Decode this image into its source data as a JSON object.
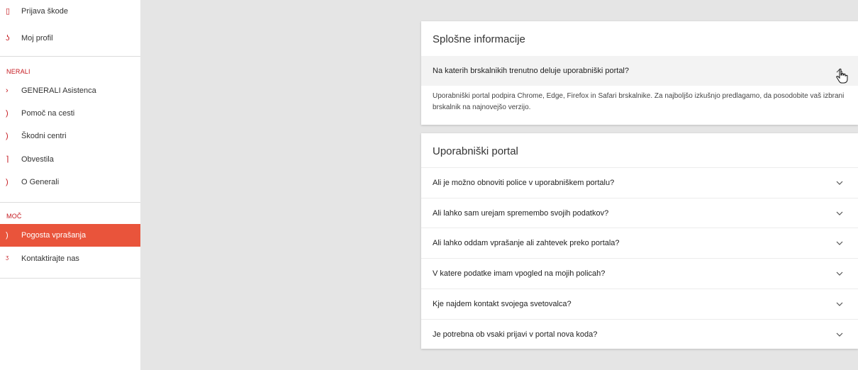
{
  "sidebar": {
    "items_top": [
      {
        "label": "Prijava škode",
        "icon": "document-icon"
      },
      {
        "label": "Moj profil",
        "icon": "user-icon"
      }
    ],
    "section_generali": "NERALI",
    "items_generali": [
      {
        "label": "GENERALI Asistenca",
        "icon": "phone-icon"
      },
      {
        "label": "Pomoč na cesti",
        "icon": "car-icon"
      },
      {
        "label": "Škodni centri",
        "icon": "location-icon"
      },
      {
        "label": "Obvestila",
        "icon": "bell-icon"
      },
      {
        "label": "O Generali",
        "icon": "info-icon"
      }
    ],
    "section_pomoc": "MOČ",
    "items_pomoc": [
      {
        "label": "Pogosta vprašanja",
        "icon": "question-icon",
        "active": true
      },
      {
        "label": "Kontaktirajte nas",
        "icon": "mail-icon"
      }
    ]
  },
  "general_card": {
    "title": "Splošne informacije",
    "question": "Na katerih brskalnikih trenutno deluje uporabniški portal?",
    "answer": "Uporabniški portal podpira Chrome, Edge, Firefox in Safari brskalnike. Za najboljšo izkušnjo predlagamo, da posodobite vaš izbrani brskalnik na najnovejšo verzijo."
  },
  "portal_card": {
    "title": "Uporabniški portal",
    "questions": [
      "Ali je možno obnoviti police v uporabniškem portalu?",
      "Ali lahko sam urejam spremembo svojih podatkov?",
      "Ali lahko oddam vprašanje ali zahtevek preko portala?",
      "V katere podatke imam vpogled na mojih policah?",
      "Kje najdem kontakt svojega svetovalca?",
      "Je potrebna ob vsaki prijavi v portal nova koda?"
    ]
  },
  "colors": {
    "accent": "#e9543b",
    "brand_red": "#c4161c"
  }
}
